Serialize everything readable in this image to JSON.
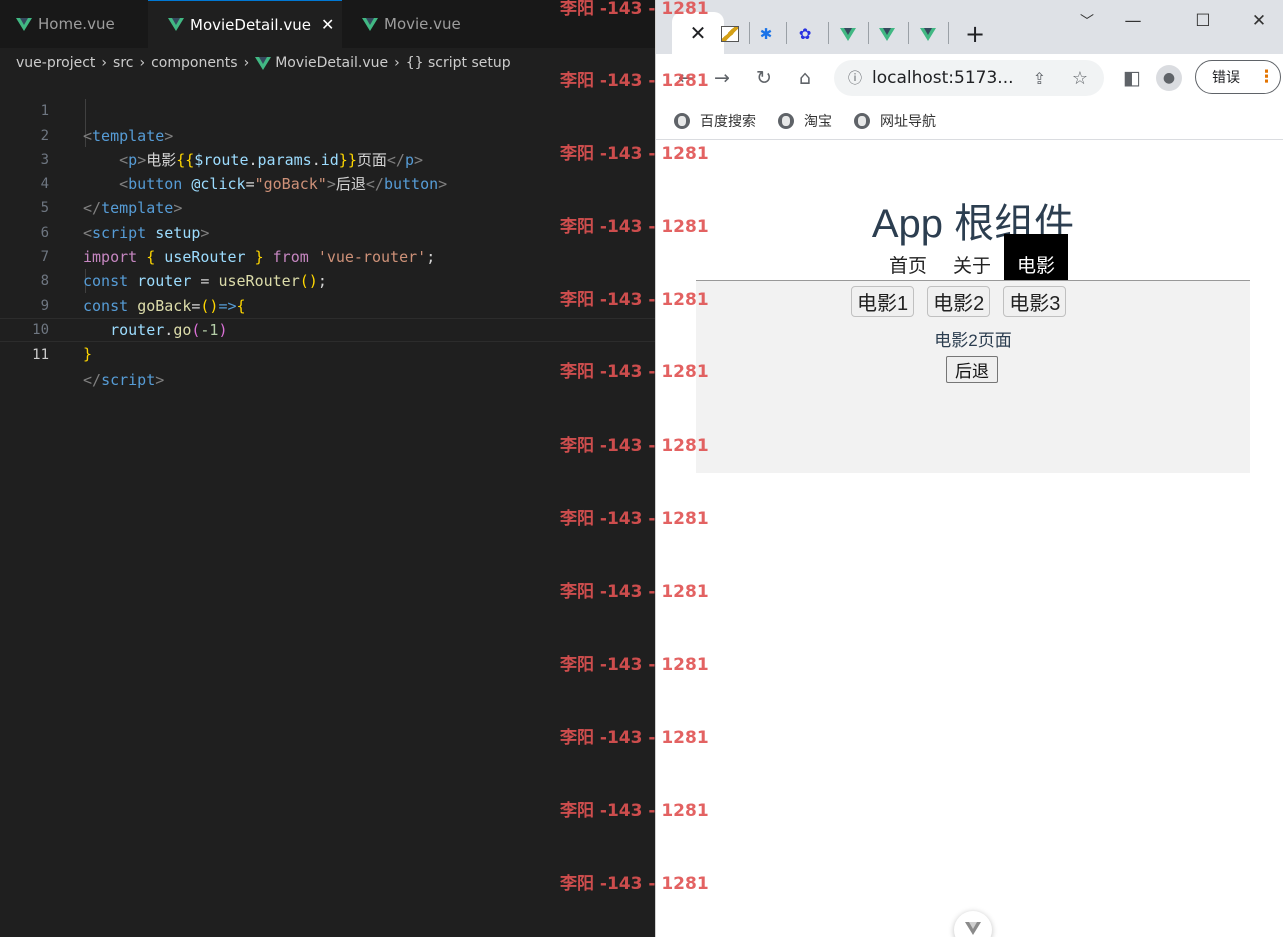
{
  "editor": {
    "tabs": [
      {
        "label": "Home.vue",
        "active": false
      },
      {
        "label": "MovieDetail.vue",
        "active": true
      },
      {
        "label": "Movie.vue",
        "active": false
      }
    ],
    "close_glyph": "✕",
    "breadcrumb": [
      "vue-project",
      "src",
      "components",
      "MovieDetail.vue",
      "{} script setup"
    ],
    "line_numbers": [
      "1",
      "2",
      "3",
      "4",
      "5",
      "6",
      "7",
      "8",
      "9",
      "10",
      "11"
    ]
  },
  "watermark": "李阳 -143 - 1281",
  "browser": {
    "tab_close": "✕",
    "new_tab": "+",
    "window_controls": {
      "dropdown": "﹀",
      "minimize": "—",
      "maximize": "☐",
      "close": "✕"
    },
    "url": "localhost:5173...",
    "error_chip": "错误",
    "bookmarks": [
      "百度搜索",
      "淘宝",
      "网址导航"
    ],
    "page": {
      "title": "App 根组件",
      "nav": [
        {
          "label": "首页",
          "active": false
        },
        {
          "label": "关于",
          "active": false
        },
        {
          "label": "电影",
          "active": true
        }
      ],
      "movie_links": [
        "电影1",
        "电影2",
        "电影3"
      ],
      "detail_text": "电影2页面",
      "back_button": "后退"
    }
  },
  "colors": {
    "editor_bg": "#1f1f1f",
    "vue_green": "#41b883",
    "watermark": "#e05252",
    "nav_active_bg": "#000000"
  }
}
